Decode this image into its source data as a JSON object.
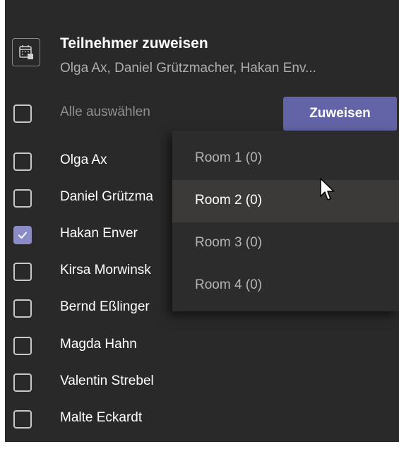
{
  "header": {
    "title": "Teilnehmer zuweisen",
    "subtitle": "Olga Ax, Daniel Grützmacher, Hakan Env..."
  },
  "select_all": {
    "label": "Alle auswählen",
    "checked": false
  },
  "assign_button": {
    "label": "Zuweisen"
  },
  "participants": [
    {
      "name": "Olga Ax",
      "checked": false
    },
    {
      "name": "Daniel Grützma",
      "checked": false
    },
    {
      "name": "Hakan Enver",
      "checked": true
    },
    {
      "name": "Kirsa Morwinsk",
      "checked": false
    },
    {
      "name": "Bernd Eßlinger",
      "checked": false
    },
    {
      "name": "Magda Hahn",
      "checked": false
    },
    {
      "name": "Valentin Strebel",
      "checked": false
    },
    {
      "name": "Malte Eckardt",
      "checked": false
    }
  ],
  "room_menu": {
    "items": [
      {
        "label": "Room 1 (0)",
        "hovered": false
      },
      {
        "label": "Room 2 (0)",
        "hovered": true
      },
      {
        "label": "Room 3 (0)",
        "hovered": false
      },
      {
        "label": "Room 4 (0)",
        "hovered": false
      }
    ]
  },
  "colors": {
    "panel_bg": "#292929",
    "accent": "#6264a7",
    "checked": "#8b8cc7",
    "menu_bg": "#2d2c2c",
    "menu_hover": "#3b3a39"
  },
  "icons": {
    "header": "calendar-assign-icon",
    "check": "checkmark-icon",
    "pointer": "mouse-pointer-icon"
  }
}
